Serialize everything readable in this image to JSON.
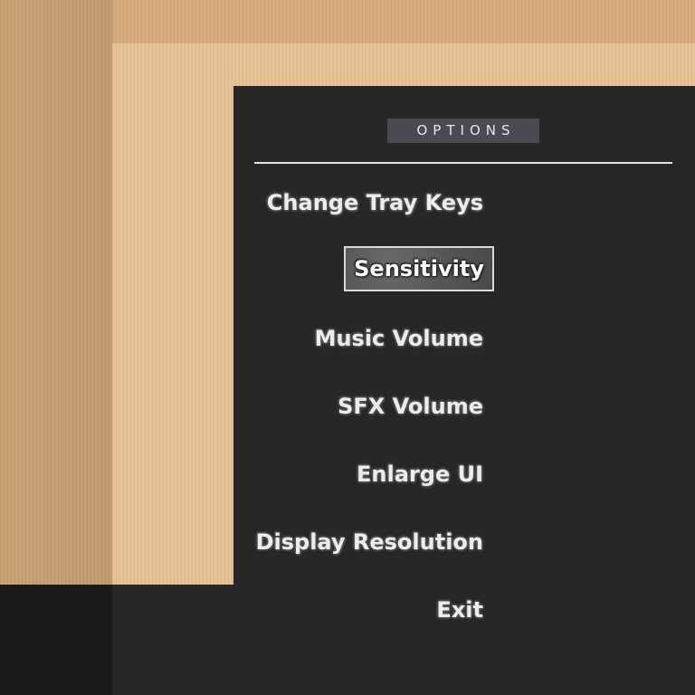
{
  "options_panel": {
    "title": "OPTIONS",
    "items": [
      {
        "label": "Change Tray Keys",
        "selected": false
      },
      {
        "label": "Sensitivity",
        "selected": true
      },
      {
        "label": "Music Volume",
        "selected": false
      },
      {
        "label": "SFX Volume",
        "selected": false
      },
      {
        "label": "Enlarge UI",
        "selected": false
      },
      {
        "label": "Display Resolution",
        "selected": false
      },
      {
        "label": "Exit",
        "selected": false
      }
    ]
  },
  "colors": {
    "panel_bg": "#272727",
    "title_bg": "#4b4a52",
    "wood_light": "#e6c196",
    "wood_dark": "#d2a679",
    "text": "#ececec"
  }
}
